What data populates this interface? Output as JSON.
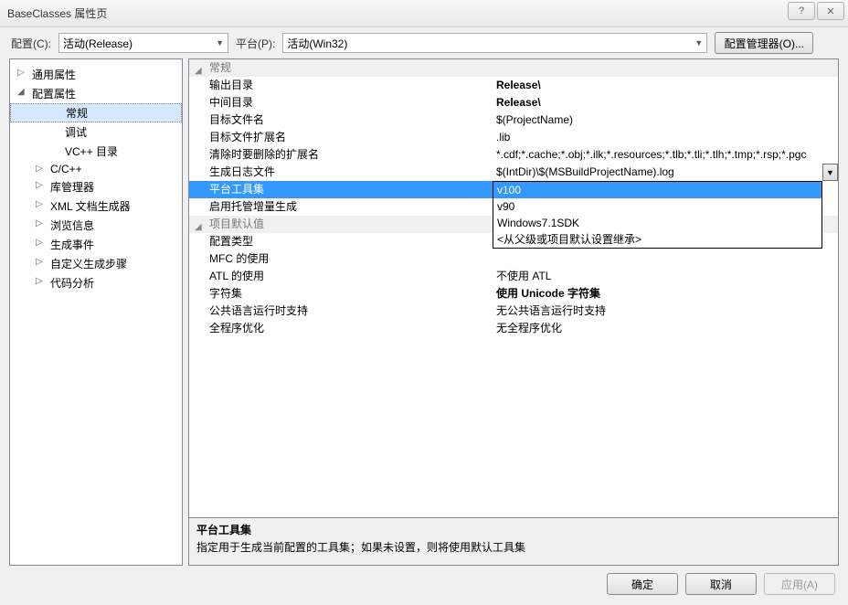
{
  "title": "BaseClasses 属性页",
  "help_glyph": "?",
  "close_glyph": "✕",
  "config_bar": {
    "config_label": "配置(C):",
    "config_value": "活动(Release)",
    "platform_label": "平台(P):",
    "platform_value": "活动(Win32)",
    "manager_label": "配置管理器(O)..."
  },
  "tree": [
    {
      "label": "通用属性",
      "level": 1,
      "exp": "▷"
    },
    {
      "label": "配置属性",
      "level": 1,
      "exp": "◢"
    },
    {
      "label": "常规",
      "level": 3,
      "selected": true
    },
    {
      "label": "调试",
      "level": 3
    },
    {
      "label": "VC++ 目录",
      "level": 3
    },
    {
      "label": "C/C++",
      "level": 2,
      "exp": "▷"
    },
    {
      "label": "库管理器",
      "level": 2,
      "exp": "▷"
    },
    {
      "label": "XML 文档生成器",
      "level": 2,
      "exp": "▷"
    },
    {
      "label": "浏览信息",
      "level": 2,
      "exp": "▷"
    },
    {
      "label": "生成事件",
      "level": 2,
      "exp": "▷"
    },
    {
      "label": "自定义生成步骤",
      "level": 2,
      "exp": "▷"
    },
    {
      "label": "代码分析",
      "level": 2,
      "exp": "▷"
    }
  ],
  "categories": [
    {
      "name": "常规",
      "rows": [
        {
          "name": "输出目录",
          "value": "Release\\",
          "bold": true
        },
        {
          "name": "中间目录",
          "value": "Release\\",
          "bold": true
        },
        {
          "name": "目标文件名",
          "value": "$(ProjectName)"
        },
        {
          "name": "目标文件扩展名",
          "value": ".lib"
        },
        {
          "name": "清除时要删除的扩展名",
          "value": "*.cdf;*.cache;*.obj;*.ilk;*.resources;*.tlb;*.tli;*.tlh;*.tmp;*.rsp;*.pgc"
        },
        {
          "name": "生成日志文件",
          "value": "$(IntDir)\\$(MSBuildProjectName).log"
        },
        {
          "name": "平台工具集",
          "value": "v100",
          "bold": true,
          "selected": true
        },
        {
          "name": "启用托管增量生成",
          "value": ""
        }
      ]
    },
    {
      "name": "项目默认值",
      "rows": [
        {
          "name": "配置类型",
          "value": ""
        },
        {
          "name": "MFC 的使用",
          "value": ""
        },
        {
          "name": "ATL 的使用",
          "value": "不使用 ATL"
        },
        {
          "name": "字符集",
          "value": "使用 Unicode 字符集",
          "bold": true
        },
        {
          "name": "公共语言运行时支持",
          "value": "无公共语言运行时支持"
        },
        {
          "name": "全程序优化",
          "value": "无全程序优化"
        }
      ]
    }
  ],
  "dropdown": {
    "options": [
      "v100",
      "v90",
      "Windows7.1SDK",
      "<从父级或项目默认设置继承>"
    ],
    "selected": "v100"
  },
  "desc": {
    "title": "平台工具集",
    "text": "指定用于生成当前配置的工具集；如果未设置，则将使用默认工具集"
  },
  "buttons": {
    "ok": "确定",
    "cancel": "取消",
    "apply": "应用(A)"
  }
}
